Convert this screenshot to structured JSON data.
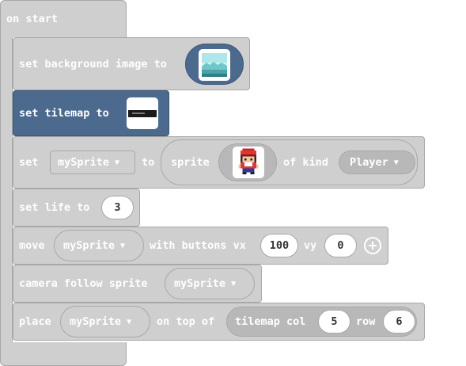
{
  "hat_block": {
    "label": "on start"
  },
  "blocks": {
    "set_background": {
      "label": "set background image to",
      "value_icon": "ocean-background-thumbnail-icon"
    },
    "set_tilemap": {
      "label": "set tilemap to",
      "value_icon": "tilemap-thumbnail-icon",
      "color": "#4b6a8e"
    },
    "set_sprite": {
      "set_label": "set",
      "variable": "mySprite",
      "to_label": "to",
      "sprite_label": "sprite",
      "sprite_icon": "player-character-sprite-icon",
      "of_kind_label": "of kind",
      "kind": "Player"
    },
    "set_life": {
      "label": "set life to",
      "value": "3"
    },
    "move": {
      "label": "move",
      "variable": "mySprite",
      "with_label": "with buttons vx",
      "vx": "100",
      "vy_label": "vy",
      "vy": "0",
      "plus_icon": "add-plus-icon"
    },
    "camera": {
      "label": "camera follow sprite",
      "variable": "mySprite"
    },
    "place": {
      "label": "place",
      "variable": "mySprite",
      "on_top_label": "on top of",
      "tilemap_label": "tilemap col",
      "col": "5",
      "row_label": "row",
      "row": "6"
    }
  },
  "caret_glyph": "▼",
  "colors": {
    "block": "#cfcfcf",
    "border": "#a8a8a8",
    "tilemap_block": "#4b6a8e",
    "reporter": "#b8b8b8",
    "ocean": "#6fc7c9"
  }
}
